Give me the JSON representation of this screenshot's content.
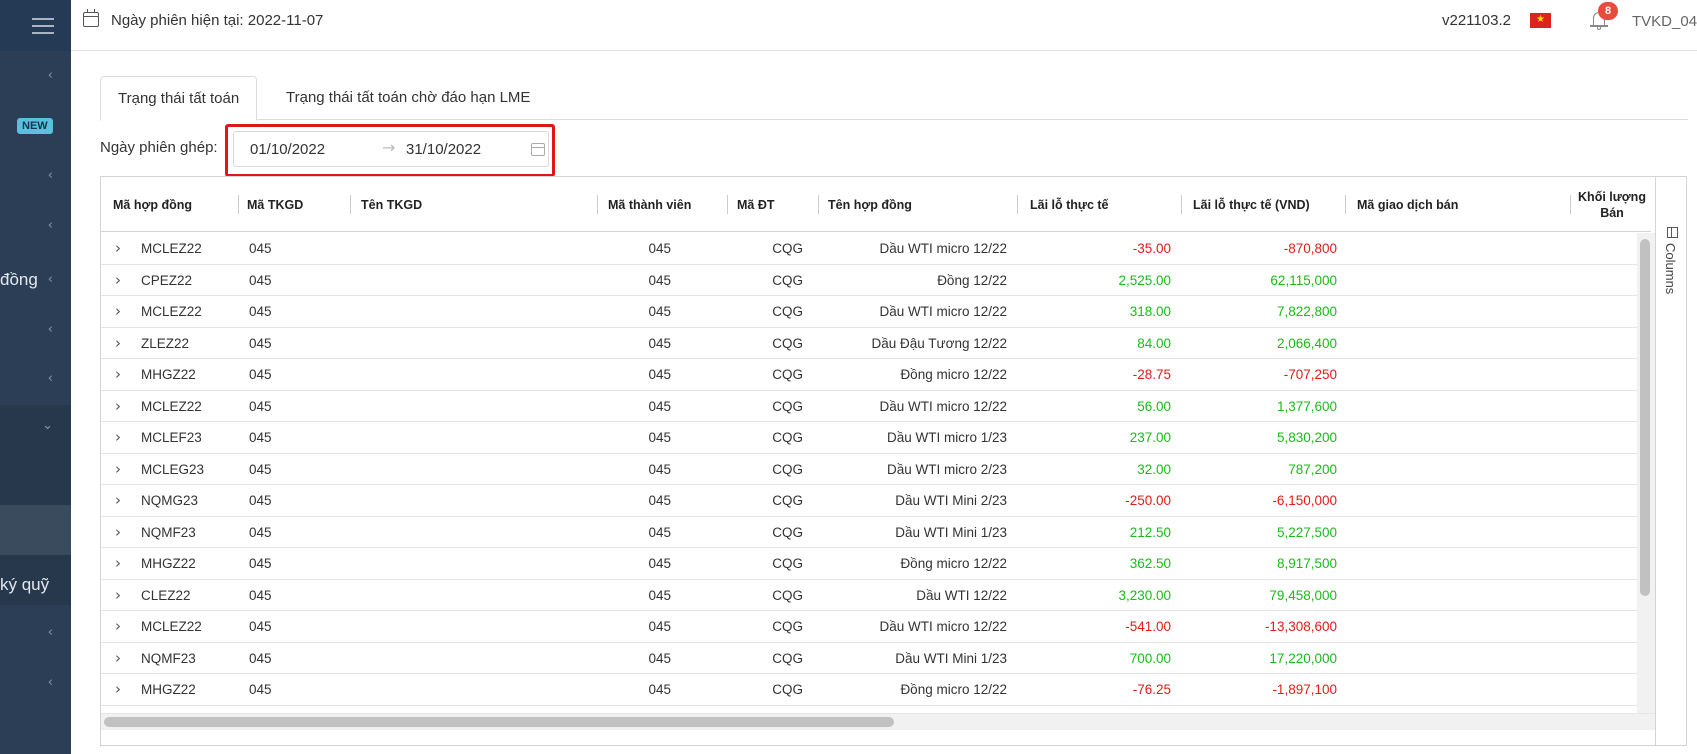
{
  "sidebar": {
    "new_badge": "NEW",
    "label_dong": "đồng",
    "label_ky_quy": "ký quỹ",
    "chevron_left": "‹",
    "chevron_down": "⌄"
  },
  "topbar": {
    "session_date": "Ngày phiên hiện tại: 2022-11-07",
    "version": "v221103.2",
    "notification_count": "8",
    "username": "TVKD_04"
  },
  "tabs": [
    {
      "label": "Trạng thái tất toán"
    },
    {
      "label": "Trạng thái tất toán chờ đáo hạn LME"
    }
  ],
  "filter": {
    "label": "Ngày phiên ghép:",
    "date_from": "01/10/2022",
    "date_to": "31/10/2022",
    "separator": "→"
  },
  "grid": {
    "columns": [
      "Mã hợp đồng",
      "Mã TKGD",
      "Tên TKGD",
      "Mã thành viên",
      "Mã ĐT",
      "Tên hợp đồng",
      "Lãi lỗ thực tế",
      "Lãi lỗ thực tế (VND)",
      "Mã giao dịch bán",
      "Khối lượng Bán"
    ],
    "side_panel_label": "Columns",
    "rows": [
      {
        "contract": "MCLEZ22",
        "account": "045",
        "member": "045",
        "partner": "CQG",
        "contract_name": "Dầu WTI micro 12/22",
        "pnl": "-35.00",
        "pnl_vnd": "-870,800"
      },
      {
        "contract": "CPEZ22",
        "account": "045",
        "member": "045",
        "partner": "CQG",
        "contract_name": "Đồng 12/22",
        "pnl": "2,525.00",
        "pnl_vnd": "62,115,000"
      },
      {
        "contract": "MCLEZ22",
        "account": "045",
        "member": "045",
        "partner": "CQG",
        "contract_name": "Dầu WTI micro 12/22",
        "pnl": "318.00",
        "pnl_vnd": "7,822,800"
      },
      {
        "contract": "ZLEZ22",
        "account": "045",
        "member": "045",
        "partner": "CQG",
        "contract_name": "Dầu Đậu Tương 12/22",
        "pnl": "84.00",
        "pnl_vnd": "2,066,400"
      },
      {
        "contract": "MHGZ22",
        "account": "045",
        "member": "045",
        "partner": "CQG",
        "contract_name": "Đồng micro 12/22",
        "pnl": "-28.75",
        "pnl_vnd": "-707,250"
      },
      {
        "contract": "MCLEZ22",
        "account": "045",
        "member": "045",
        "partner": "CQG",
        "contract_name": "Dầu WTI micro 12/22",
        "pnl": "56.00",
        "pnl_vnd": "1,377,600"
      },
      {
        "contract": "MCLEF23",
        "account": "045",
        "member": "045",
        "partner": "CQG",
        "contract_name": "Dầu WTI micro 1/23",
        "pnl": "237.00",
        "pnl_vnd": "5,830,200"
      },
      {
        "contract": "MCLEG23",
        "account": "045",
        "member": "045",
        "partner": "CQG",
        "contract_name": "Dầu WTI micro 2/23",
        "pnl": "32.00",
        "pnl_vnd": "787,200"
      },
      {
        "contract": "NQMG23",
        "account": "045",
        "member": "045",
        "partner": "CQG",
        "contract_name": "Dầu WTI Mini 2/23",
        "pnl": "-250.00",
        "pnl_vnd": "-6,150,000"
      },
      {
        "contract": "NQMF23",
        "account": "045",
        "member": "045",
        "partner": "CQG",
        "contract_name": "Dầu WTI Mini 1/23",
        "pnl": "212.50",
        "pnl_vnd": "5,227,500"
      },
      {
        "contract": "MHGZ22",
        "account": "045",
        "member": "045",
        "partner": "CQG",
        "contract_name": "Đồng micro 12/22",
        "pnl": "362.50",
        "pnl_vnd": "8,917,500"
      },
      {
        "contract": "CLEZ22",
        "account": "045",
        "member": "045",
        "partner": "CQG",
        "contract_name": "Dầu WTI 12/22",
        "pnl": "3,230.00",
        "pnl_vnd": "79,458,000"
      },
      {
        "contract": "MCLEZ22",
        "account": "045",
        "member": "045",
        "partner": "CQG",
        "contract_name": "Dầu WTI micro 12/22",
        "pnl": "-541.00",
        "pnl_vnd": "-13,308,600"
      },
      {
        "contract": "NQMF23",
        "account": "045",
        "member": "045",
        "partner": "CQG",
        "contract_name": "Dầu WTI Mini 1/23",
        "pnl": "700.00",
        "pnl_vnd": "17,220,000"
      },
      {
        "contract": "MHGZ22",
        "account": "045",
        "member": "045",
        "partner": "CQG",
        "contract_name": "Đồng micro 12/22",
        "pnl": "-76.25",
        "pnl_vnd": "-1,897,100"
      }
    ]
  },
  "colors": {
    "sidebar_bg": "#2c3e55",
    "negative": "#e31b1b",
    "positive": "#1bbb1b",
    "highlight": "#e21616",
    "badge": "#e74c3c"
  }
}
